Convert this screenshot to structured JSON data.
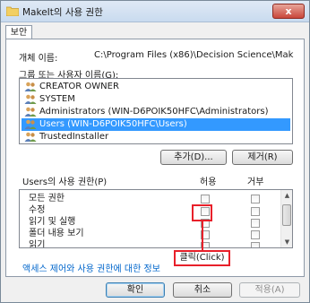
{
  "window": {
    "title": "MakeIt의 사용 권한",
    "close_label": "x"
  },
  "tab": {
    "label": "보안"
  },
  "object": {
    "label": "개체 이름:",
    "value": "C:\\Program Files (x86)\\Decision Science\\Mak"
  },
  "groups": {
    "label": "그룹 또는 사용자 이름(G):",
    "items": [
      {
        "label": "CREATOR OWNER",
        "selected": false
      },
      {
        "label": "SYSTEM",
        "selected": false
      },
      {
        "label": "Administrators (WIN-D6POIK50HFC\\Administrators)",
        "selected": false
      },
      {
        "label": "Users (WIN-D6POIK50HFC\\Users)",
        "selected": true
      },
      {
        "label": "TrustedInstaller",
        "selected": false
      }
    ],
    "icon": "users-icon"
  },
  "buttons": {
    "add": "추가(D)...",
    "remove": "제거(R)",
    "ok": "확인",
    "cancel": "취소",
    "apply": "적용(A)"
  },
  "permissions": {
    "label": "Users의 사용 권한(P)",
    "allow_header": "허용",
    "deny_header": "거부",
    "rows": [
      {
        "label": "모든 권한"
      },
      {
        "label": "수정"
      },
      {
        "label": "읽기 및 실행"
      },
      {
        "label": "폴더 내용 보기"
      },
      {
        "label": "읽기"
      }
    ]
  },
  "link": {
    "text": "액세스 제어와 사용 권한에 대한 정보"
  },
  "annotation": {
    "text": "클릭(Click)",
    "color": "#e8202a"
  }
}
